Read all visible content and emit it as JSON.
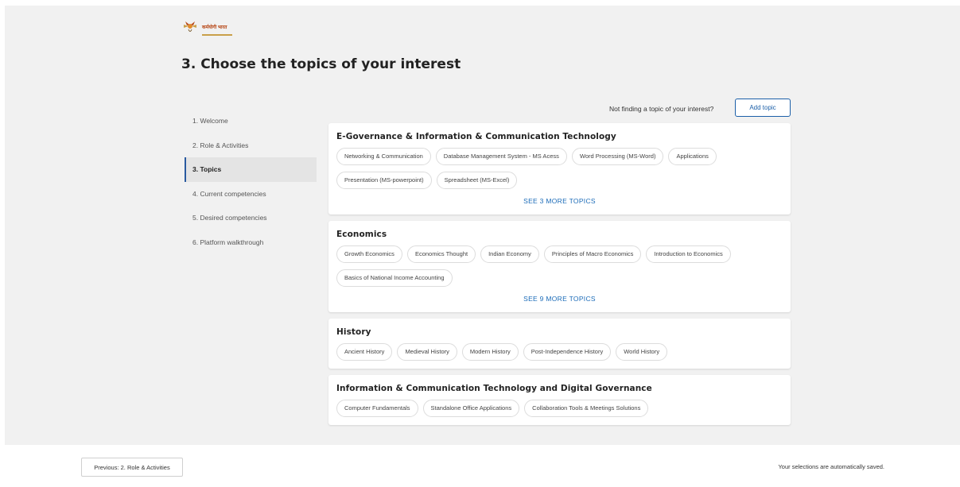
{
  "header": {
    "logo_text": "कर्मयोगी भारत",
    "page_title": "3. Choose the topics of your interest"
  },
  "sidebar": {
    "items": [
      {
        "label": "1. Welcome"
      },
      {
        "label": "2. Role & Activities"
      },
      {
        "label": "3. Topics"
      },
      {
        "label": "4. Current competencies"
      },
      {
        "label": "5. Desired competencies"
      },
      {
        "label": "6. Platform walkthrough"
      }
    ]
  },
  "topics_header": {
    "prompt": "Not finding a topic of your interest?",
    "add_label": "Add topic"
  },
  "sections": [
    {
      "title": "E-Governance & Information & Communication Technology",
      "chips": [
        "Networking & Communication",
        "Database Management System - MS Acess",
        "Word Processing (MS-Word)",
        "Applications",
        "Presentation (MS-powerpoint)",
        "Spreadsheet (MS-Excel)"
      ],
      "more": "SEE 3 MORE TOPICS"
    },
    {
      "title": "Economics",
      "chips": [
        "Growth Economics",
        "Economics Thought",
        "Indian Economy",
        "Principles of Macro Economics",
        "Introduction to Economics",
        "Basics of National Income Accounting"
      ],
      "more": "SEE 9 MORE TOPICS"
    },
    {
      "title": "History",
      "chips": [
        "Ancient History",
        "Medieval History",
        "Modern History",
        "Post-Independence History",
        "World History"
      ],
      "more": ""
    },
    {
      "title": "Information & Communication Technology and Digital Governance",
      "chips": [
        "Computer Fundamentals",
        "Standalone Office Applications",
        "Collaboration Tools & Meetings Solutions"
      ],
      "more": ""
    }
  ],
  "footer": {
    "prev_label": "Previous: 2. Role & Activities",
    "saved_text": "Your selections are automatically saved."
  },
  "colors": {
    "accent": "#1b5fa8",
    "link": "#1b6bb8",
    "page_bg": "#f1f1f1"
  }
}
